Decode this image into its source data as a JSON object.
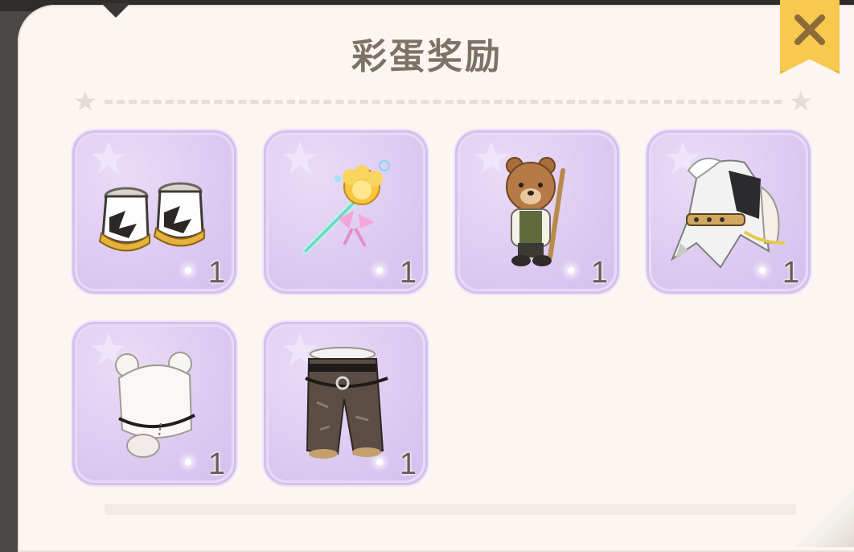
{
  "dialog": {
    "title": "彩蛋奖励",
    "close_icon": "close-icon",
    "accent_color": "#f7c94f",
    "card_color": "#e1cff4"
  },
  "rewards": [
    {
      "name": "star-boots",
      "icon": "boots-icon",
      "count": "1"
    },
    {
      "name": "magic-wand",
      "icon": "wand-icon",
      "count": "1"
    },
    {
      "name": "teddy-bear-pet",
      "icon": "teddy-bear-icon",
      "count": "1"
    },
    {
      "name": "punk-jacket",
      "icon": "jacket-icon",
      "count": "1"
    },
    {
      "name": "bear-hood",
      "icon": "hood-icon",
      "count": "1"
    },
    {
      "name": "cargo-pants",
      "icon": "pants-icon",
      "count": "1"
    }
  ]
}
